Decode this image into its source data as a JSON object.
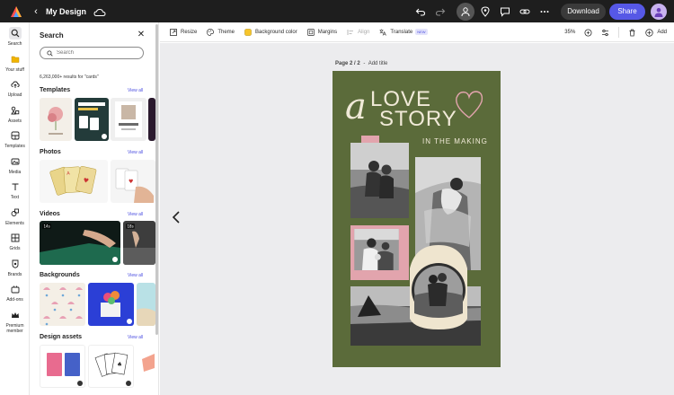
{
  "topbar": {
    "doc_title": "My Design",
    "download_label": "Download",
    "share_label": "Share"
  },
  "rail": {
    "items": [
      {
        "label": "Search",
        "icon": "search-icon"
      },
      {
        "label": "Your stuff",
        "icon": "folder-icon"
      },
      {
        "label": "Upload",
        "icon": "upload-icon"
      },
      {
        "label": "Assets",
        "icon": "assets-icon"
      },
      {
        "label": "Templates",
        "icon": "templates-icon"
      },
      {
        "label": "Media",
        "icon": "media-icon"
      },
      {
        "label": "Text",
        "icon": "text-icon"
      },
      {
        "label": "Elements",
        "icon": "elements-icon"
      },
      {
        "label": "Grids",
        "icon": "grid-icon"
      },
      {
        "label": "Brands",
        "icon": "brand-icon"
      },
      {
        "label": "Add-ons",
        "icon": "addons-icon"
      },
      {
        "label": "Premium member",
        "icon": "crown-icon"
      }
    ]
  },
  "panel": {
    "title": "Search",
    "search_placeholder": "Search",
    "results": "6,263,000+ results for \"cards\"",
    "sections": [
      {
        "title": "Templates",
        "view_all": "View all"
      },
      {
        "title": "Photos",
        "view_all": "View all"
      },
      {
        "title": "Videos",
        "view_all": "View all"
      },
      {
        "title": "Backgrounds",
        "view_all": "View all"
      },
      {
        "title": "Design assets",
        "view_all": "View all"
      }
    ],
    "video_badges": [
      "14s",
      "18s"
    ]
  },
  "toolbar": {
    "resize": "Resize",
    "theme": "Theme",
    "background_color": "Background color",
    "margins": "Margins",
    "align": "Align",
    "translate": "Translate",
    "new_badge": "NEW",
    "zoom": "35%",
    "add": "Add"
  },
  "canvas": {
    "page_label": "Page 2 / 2",
    "add_title": "Add title",
    "design": {
      "letter_a": "a",
      "love": "LOVE",
      "story": "STORY",
      "tagline": "IN THE MAKING"
    }
  },
  "colors": {
    "accent": "#5658e6",
    "design_bg": "#5b6b3a",
    "cream": "#f1ead8",
    "pink": "#e2a4ad"
  }
}
